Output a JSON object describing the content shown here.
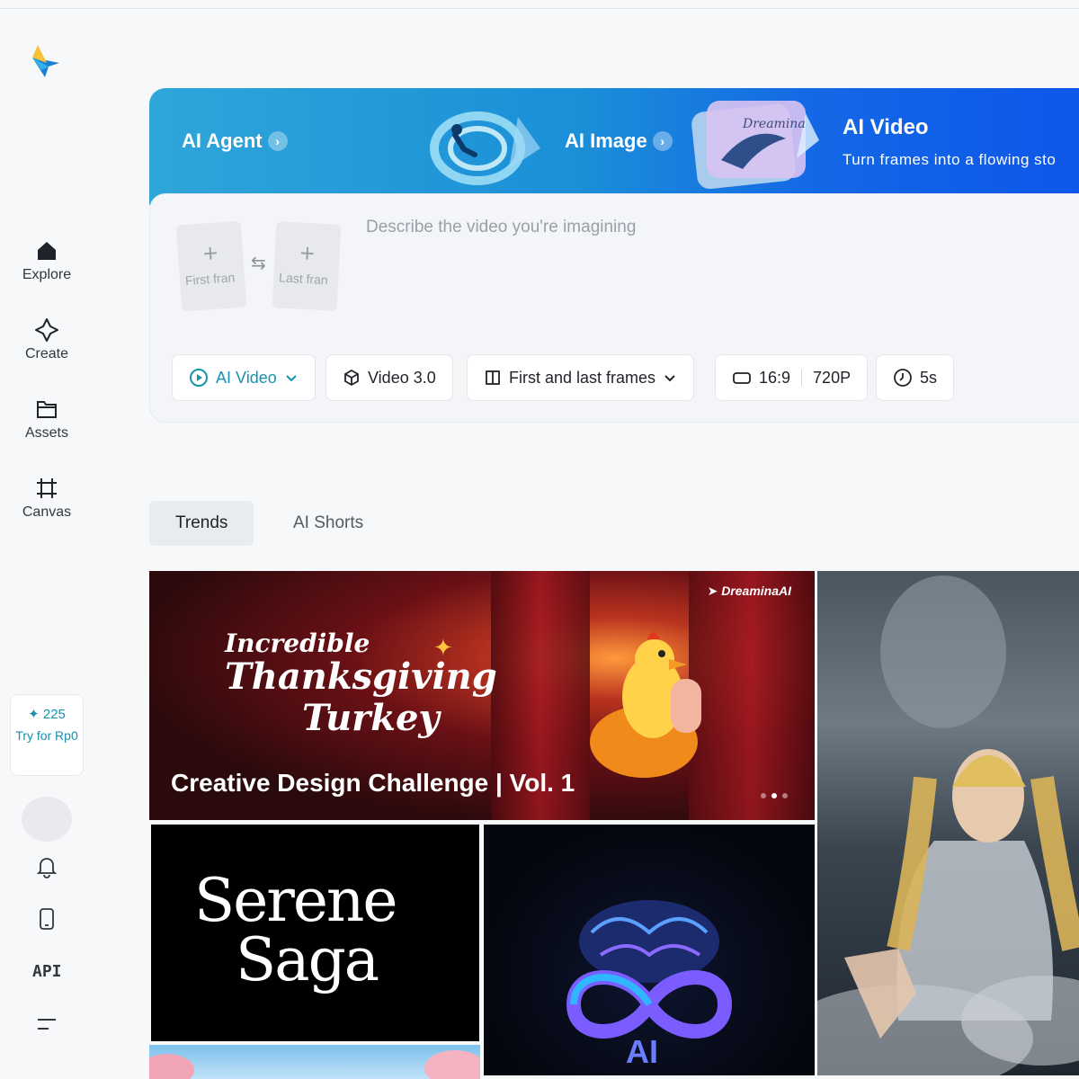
{
  "sidebar": {
    "nav": [
      {
        "label": "Explore",
        "icon": "home-icon"
      },
      {
        "label": "Create",
        "icon": "sparkle-icon"
      },
      {
        "label": "Assets",
        "icon": "folder-icon"
      },
      {
        "label": "Canvas",
        "icon": "crop-icon"
      }
    ],
    "credits": {
      "count": "225",
      "cta": "Try for Rp0"
    },
    "api_label": "API"
  },
  "banner": {
    "agent_label": "AI Agent",
    "image_label": "AI Image",
    "video_title": "AI Video",
    "video_subtitle": "Turn frames into a flowing sto",
    "image_art_script": "Dreamina"
  },
  "composer": {
    "first_frame_label": "First fran",
    "last_frame_label": "Last fran",
    "prompt_placeholder": "Describe the video you're imagining",
    "chips": {
      "mode": "AI Video",
      "model": "Video 3.0",
      "frames": "First and last frames",
      "ratio": "16:9",
      "resolution": "720P",
      "duration": "5s"
    }
  },
  "tabs": {
    "trends": "Trends",
    "shorts": "AI Shorts"
  },
  "gallery": {
    "hero": {
      "line1": "Incredible",
      "line2": "Thanksgiving",
      "line3": "Turkey",
      "brand": "DreaminaAI",
      "title": "Creative Design Challenge | Vol. 1"
    },
    "serene": {
      "line1": "Serene",
      "line2": "Saga"
    },
    "ai_tile_text": "AI"
  },
  "colors": {
    "accent": "#1593b0",
    "banner_start": "#2ea6d9",
    "banner_end": "#0d55ea"
  }
}
